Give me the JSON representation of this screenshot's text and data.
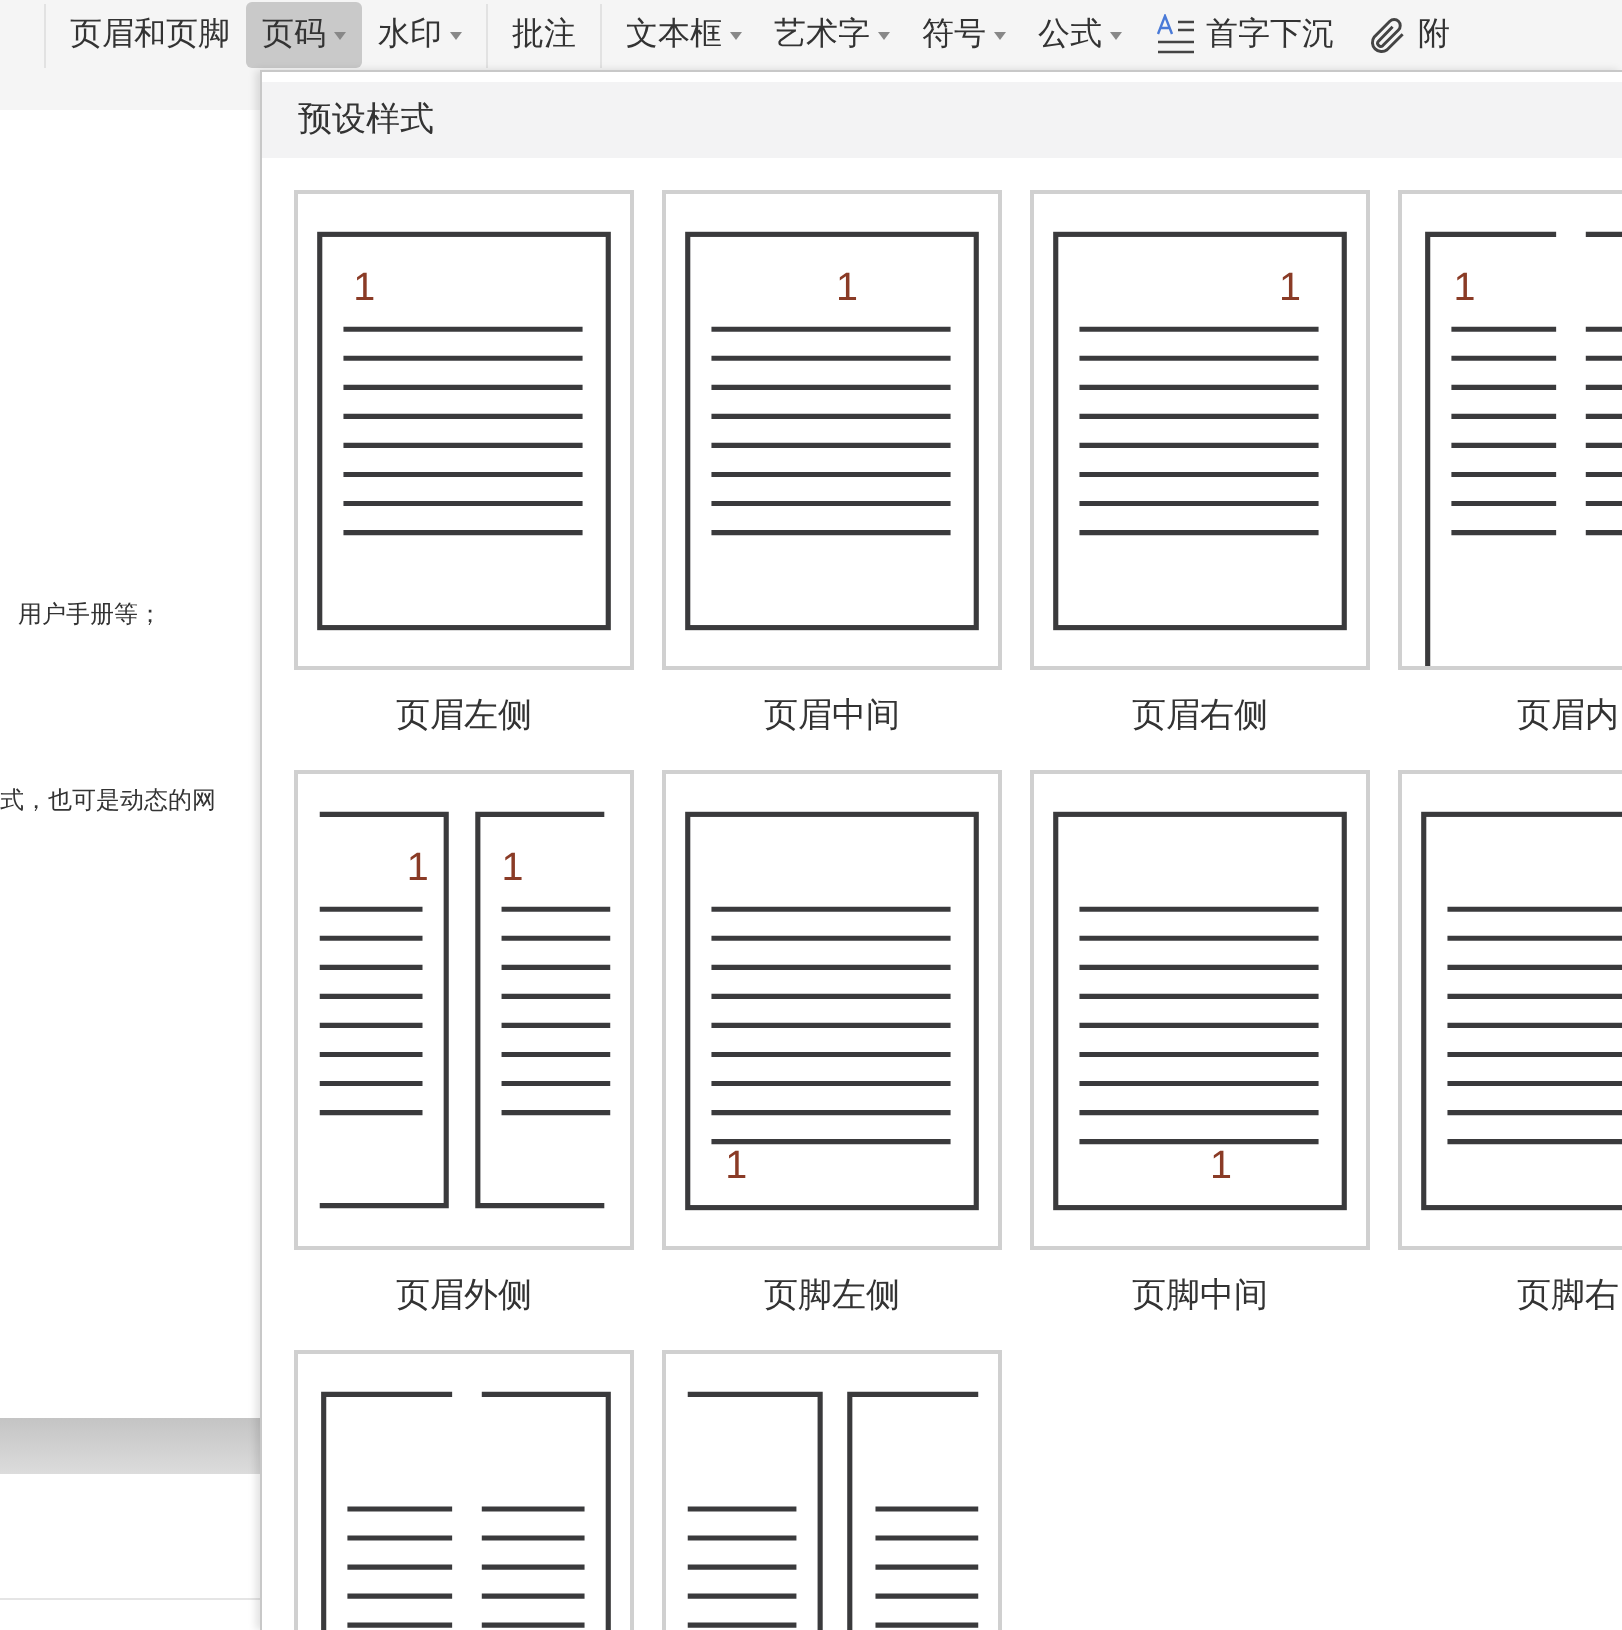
{
  "toolbar": [
    {
      "label": "页眉和页脚",
      "kind": "plain",
      "selected": false
    },
    {
      "label": "页码",
      "kind": "dropdown",
      "selected": true
    },
    {
      "label": "水印",
      "kind": "dropdown",
      "selected": false
    },
    {
      "label": "批注",
      "kind": "plain",
      "selected": false
    },
    {
      "label": "文本框",
      "kind": "dropdown",
      "selected": false
    },
    {
      "label": "艺术字",
      "kind": "dropdown",
      "selected": false
    },
    {
      "label": "符号",
      "kind": "dropdown",
      "selected": false
    },
    {
      "label": "公式",
      "kind": "dropdown",
      "selected": false
    },
    {
      "label": "首字下沉",
      "kind": "dropcap",
      "selected": false
    },
    {
      "label": "附",
      "kind": "attachment",
      "selected": false
    }
  ],
  "document": {
    "lines": [
      "用户手册等；",
      "式，也可是动态的网"
    ]
  },
  "panel": {
    "title": "预设样式",
    "presets": [
      {
        "label": "页眉左侧",
        "kind": "header-left",
        "number": "1"
      },
      {
        "label": "页眉中间",
        "kind": "header-center",
        "number": "1"
      },
      {
        "label": "页眉右侧",
        "kind": "header-right",
        "number": "1"
      },
      {
        "label": "页眉内",
        "kind": "header-inside",
        "number": "1"
      },
      {
        "label": "页眉外侧",
        "kind": "header-outside",
        "numbers": [
          "1",
          "1"
        ]
      },
      {
        "label": "页脚左侧",
        "kind": "footer-left",
        "number": "1"
      },
      {
        "label": "页脚中间",
        "kind": "footer-center",
        "number": "1"
      },
      {
        "label": "页脚右",
        "kind": "footer-right"
      },
      {
        "kind": "footer-inside"
      },
      {
        "kind": "footer-outside"
      }
    ]
  }
}
